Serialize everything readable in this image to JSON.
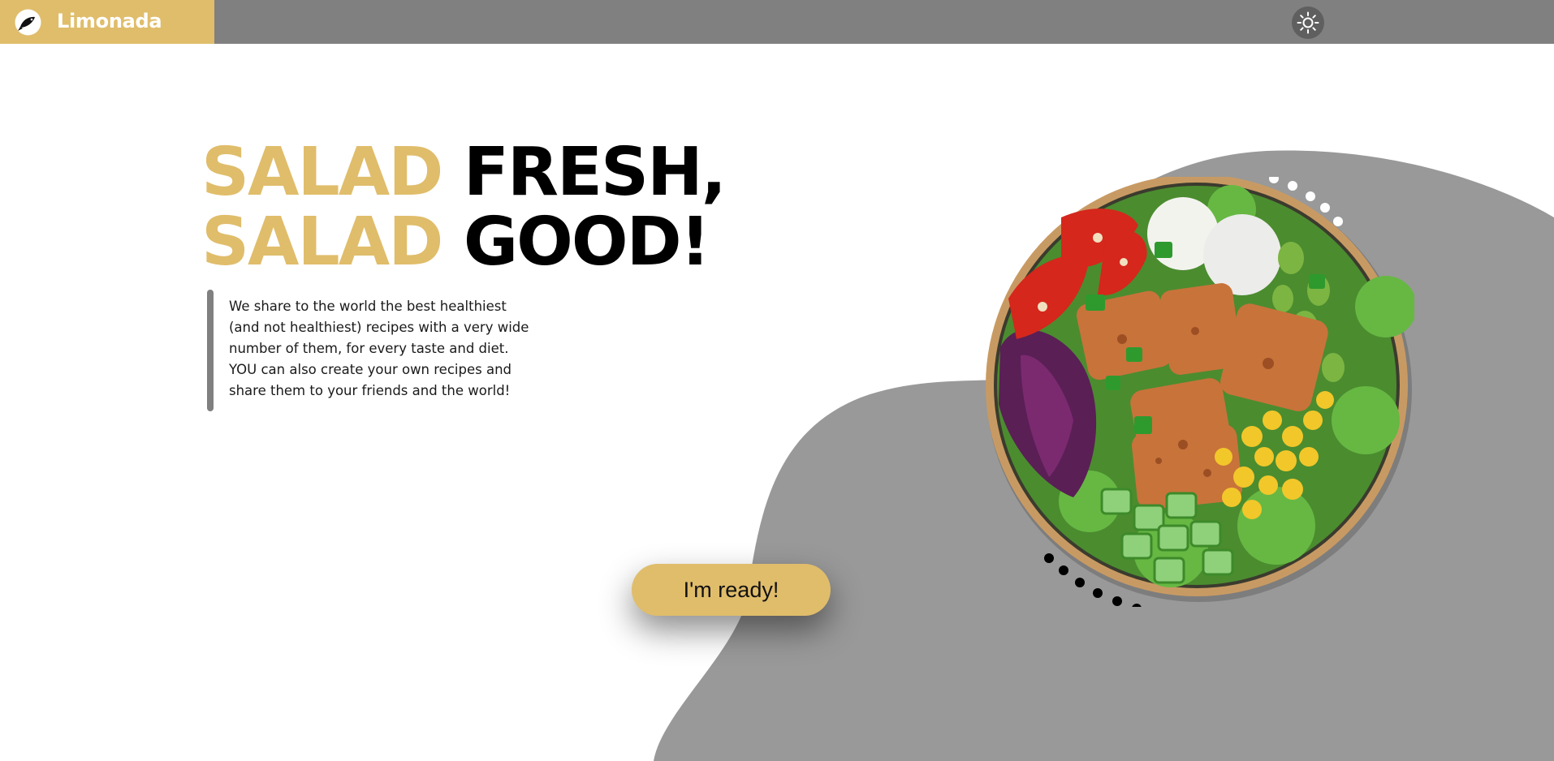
{
  "header": {
    "brand_name": "Limonada",
    "logo_icon": "fish-icon",
    "theme_toggle_icon": "sun-icon",
    "brand_color": "#e0bd6b",
    "bar_color": "#808080"
  },
  "hero": {
    "title_lines": [
      {
        "accent": "SALAD",
        "text": " FRESH,"
      },
      {
        "accent": "SALAD",
        "text": " GOOD!"
      }
    ],
    "description_lines": [
      "We share to the world the best healthiest",
      "(and not healthiest) recipes with a very wide",
      "number of them, for every taste and diet.",
      "YOU can also create your own recipes and",
      "share them to your friends and the world!"
    ],
    "cta_label": "I'm ready!",
    "accent_color": "#e0bd6b",
    "blob_color": "#999999"
  },
  "image": {
    "subject": "salad-bowl-image"
  }
}
